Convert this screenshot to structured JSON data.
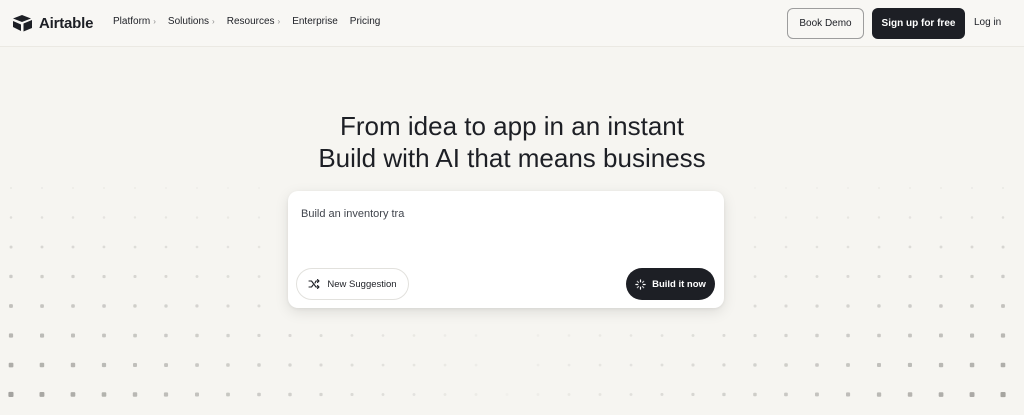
{
  "header": {
    "brand": "Airtable",
    "nav": [
      {
        "label": "Platform",
        "chevron": "›"
      },
      {
        "label": "Solutions",
        "chevron": "›"
      },
      {
        "label": "Resources",
        "chevron": "›"
      },
      {
        "label": "Enterprise",
        "chevron": ""
      },
      {
        "label": "Pricing",
        "chevron": ""
      }
    ],
    "book_demo": "Book Demo",
    "sign_up": "Sign up for free",
    "log_in": "Log in"
  },
  "hero": {
    "line1": "From idea to app in an instant",
    "line2": "Build with AI that means business"
  },
  "prompt": {
    "value": "Build an inventory tra",
    "new_suggestion": "New Suggestion",
    "build_now": "Build it now"
  },
  "colors": {
    "background": "#f6f5f1",
    "primary_dark": "#1d1f25"
  },
  "icons": {
    "logo": "airtable-logo-icon",
    "shuffle": "shuffle-icon",
    "spinner": "spinner-icon"
  }
}
